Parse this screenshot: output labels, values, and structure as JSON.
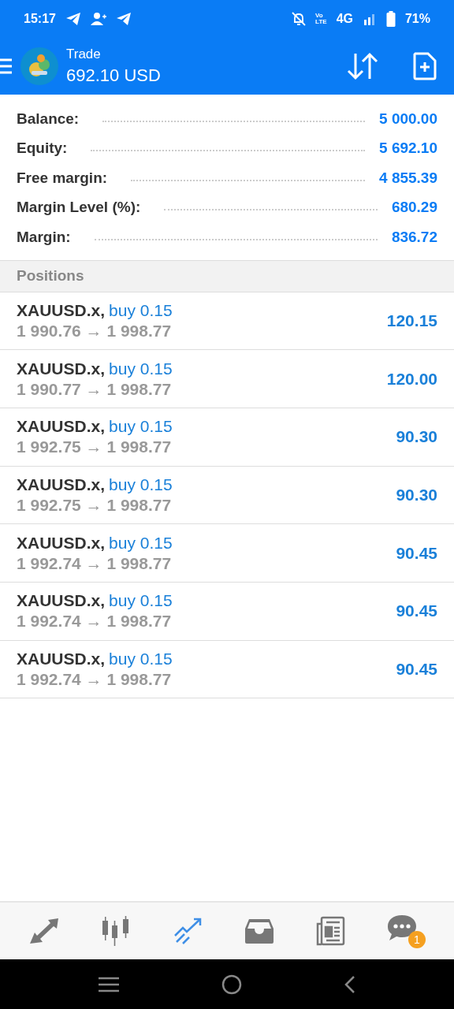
{
  "status_bar": {
    "time": "15:17",
    "volte": [
      "Vo",
      "LTE"
    ],
    "network": "4G",
    "battery": "71%"
  },
  "header": {
    "title": "Trade",
    "subtitle": "692.10 USD"
  },
  "summary": [
    {
      "label": "Balance:",
      "value": "5 000.00"
    },
    {
      "label": "Equity:",
      "value": "5 692.10"
    },
    {
      "label": "Free margin:",
      "value": "4 855.39"
    },
    {
      "label": "Margin Level (%):",
      "value": "680.29"
    },
    {
      "label": "Margin:",
      "value": "836.72"
    }
  ],
  "positions": {
    "title": "Positions",
    "rows": [
      {
        "symbol": "XAUUSD.x,",
        "side": "buy 0.15",
        "prices": "1 990.76 → 1 998.77",
        "profit": "120.15"
      },
      {
        "symbol": "XAUUSD.x,",
        "side": "buy 0.15",
        "prices": "1 990.77 → 1 998.77",
        "profit": "120.00"
      },
      {
        "symbol": "XAUUSD.x,",
        "side": "buy 0.15",
        "prices": "1 992.75 → 1 998.77",
        "profit": "90.30"
      },
      {
        "symbol": "XAUUSD.x,",
        "side": "buy 0.15",
        "prices": "1 992.75 → 1 998.77",
        "profit": "90.30"
      },
      {
        "symbol": "XAUUSD.x,",
        "side": "buy 0.15",
        "prices": "1 992.74 → 1 998.77",
        "profit": "90.45"
      },
      {
        "symbol": "XAUUSD.x,",
        "side": "buy 0.15",
        "prices": "1 992.74 → 1 998.77",
        "profit": "90.45"
      },
      {
        "symbol": "XAUUSD.x,",
        "side": "buy 0.15",
        "prices": "1 992.74 → 1 998.77",
        "profit": "90.45"
      }
    ]
  },
  "bottom_nav": [
    {
      "kind": "quotes",
      "selected": false
    },
    {
      "kind": "chart",
      "selected": false
    },
    {
      "kind": "trade",
      "selected": true
    },
    {
      "kind": "history",
      "selected": false
    },
    {
      "kind": "news",
      "selected": false
    },
    {
      "kind": "chat",
      "selected": false,
      "badge": "1"
    }
  ]
}
